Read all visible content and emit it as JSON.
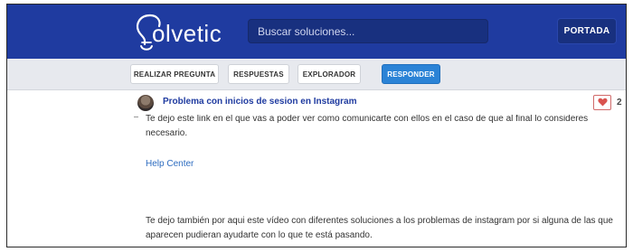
{
  "header": {
    "logo_text": "olvetic",
    "search_placeholder": "Buscar soluciones...",
    "portada_label": "PORTADA"
  },
  "subnav": {
    "items": [
      {
        "label": "REALIZAR PREGUNTA"
      },
      {
        "label": "RESPUESTAS"
      },
      {
        "label": "EXPLORADOR"
      },
      {
        "label": "RESPONDER"
      }
    ]
  },
  "question": {
    "title": "Problema con inicios de sesion en Instagram",
    "likes": "2"
  },
  "answer": {
    "paragraph1": "Te dejo este link en el que vas a poder ver como comunicarte con ellos en el caso de que al final lo consideres necesario.",
    "link_text": "Help Center",
    "paragraph2": "Te dejo también por aqui este vídeo con diferentes soluciones a los problemas de instagram por si alguna de las que aparecen pudieran ayudarte con lo que te está pasando."
  },
  "colors": {
    "header_bg": "#1f3ba0",
    "accent_button": "#2b83d6",
    "link": "#2d6cc0"
  }
}
